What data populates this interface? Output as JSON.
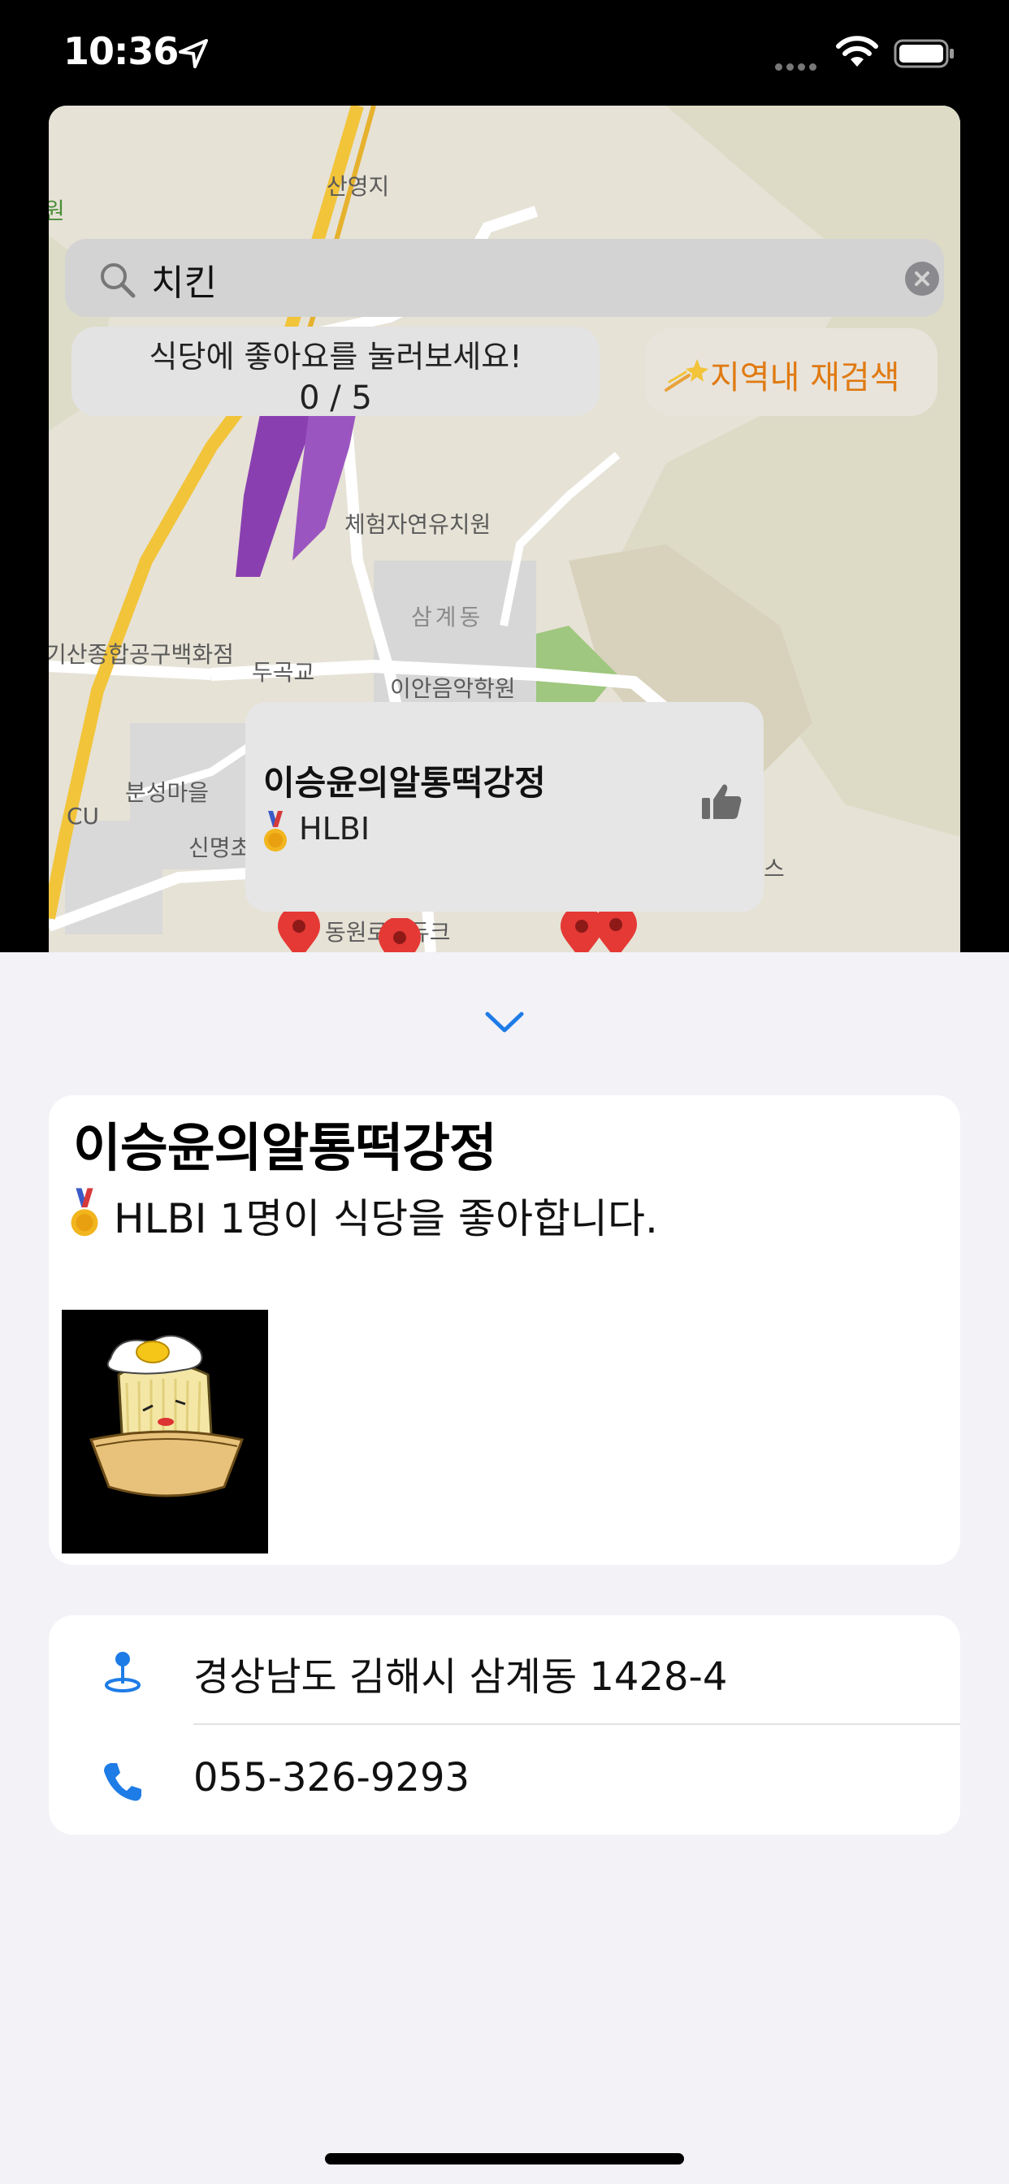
{
  "status_bar": {
    "time": "10:36",
    "icons": [
      "location-arrow-icon",
      "cellular-icon",
      "wifi-icon",
      "battery-icon"
    ]
  },
  "map": {
    "labels": [
      "산영지",
      "원",
      "체험자연유치원",
      "삼계동",
      "기산종합공구백화점",
      "두곡교",
      "이안음악학원",
      "분성마을",
      "CU",
      "신명초",
      "스",
      "동원로얄듀크"
    ],
    "search": {
      "value": "치킨",
      "icon": "magnifying-glass-icon",
      "clear_icon": "clear-icon"
    },
    "like_prompt": {
      "text": "식당에 좋아요를 눌러보세요!",
      "count": "0 / 5"
    },
    "research_button": {
      "label": "지역내 재검색",
      "icon": "shooting-star-icon",
      "color": "#E07A12"
    },
    "callout": {
      "title": "이승윤의알통떡강정",
      "user": "HLBI",
      "medal_icon": "gold-medal-icon",
      "like_icon": "thumbs-up-icon"
    },
    "pin_color": "#E53935"
  },
  "sheet": {
    "collapse_icon": "chevron-down-icon",
    "restaurant": {
      "name": "이승윤의알통떡강정",
      "likes_text": "HLBI 1명이 식당을 좋아합니다.",
      "medal_icon": "gold-medal-icon",
      "photo": "fried-rice-cake-cartoon-image"
    },
    "info": {
      "address": "경상남도 김해시 삼계동 1428-4",
      "address_icon": "location-pin-icon",
      "phone": "055-326-9293",
      "phone_icon": "phone-icon",
      "accent_color": "#1E7CE6"
    }
  }
}
